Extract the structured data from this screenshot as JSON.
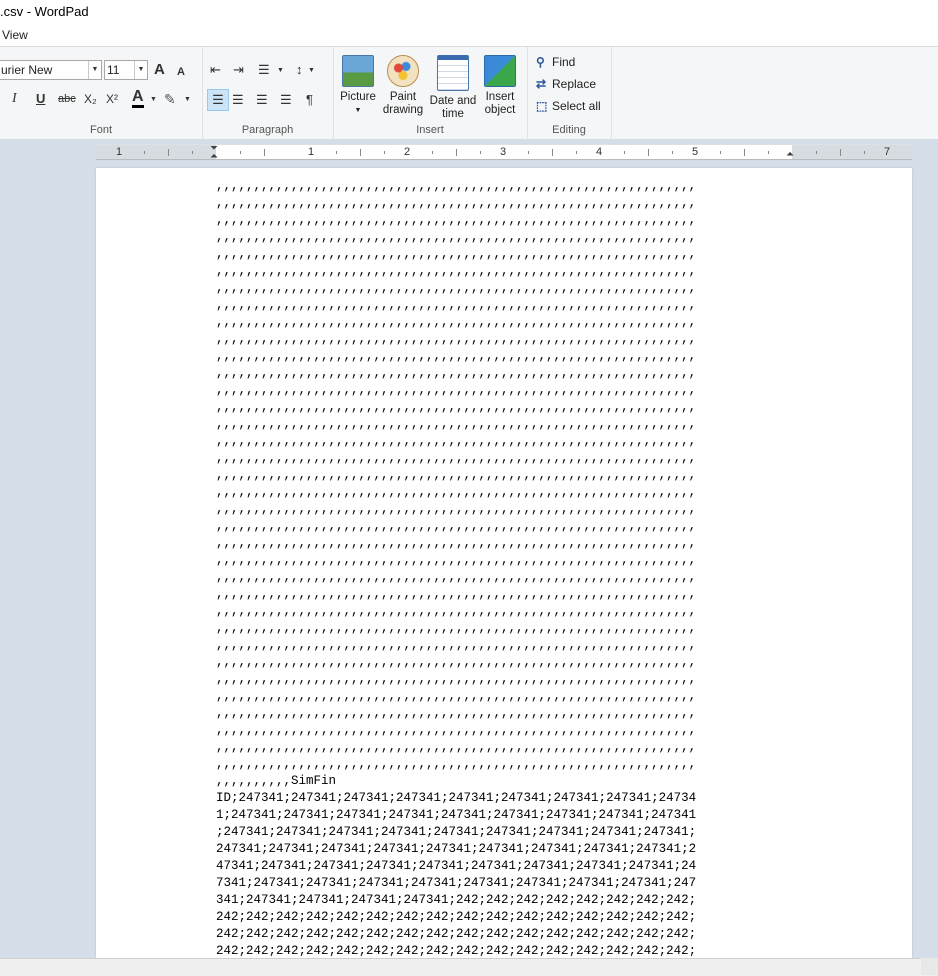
{
  "window": {
    "title": ".csv - WordPad"
  },
  "menu": {
    "view": "View"
  },
  "ribbon": {
    "font": {
      "family": "urier New",
      "size": "11",
      "label": "Font",
      "grow": "A",
      "shrink": "A",
      "italic": "I",
      "underline": "U",
      "strike": "abc",
      "sub": "X₂",
      "sup": "X²",
      "color_letter": "A"
    },
    "paragraph": {
      "label": "Paragraph"
    },
    "insert": {
      "label": "Insert",
      "picture": "Picture",
      "paint": "Paint drawing",
      "datetime": "Date and time",
      "object": "Insert object"
    },
    "editing": {
      "label": "Editing",
      "find": "Find",
      "replace": "Replace",
      "select_all": "Select all"
    }
  },
  "ruler": {
    "numbers": [
      "1",
      "1",
      "2",
      "3",
      "4",
      "5",
      "7"
    ]
  },
  "document": {
    "text": ",,,,,,,,,,,,,,,,,,,,,,,,,,,,,,,,,,,,,,,,,,,,,,,,,,,,,,,,,,,,,,,,\n,,,,,,,,,,,,,,,,,,,,,,,,,,,,,,,,,,,,,,,,,,,,,,,,,,,,,,,,,,,,,,,,\n,,,,,,,,,,,,,,,,,,,,,,,,,,,,,,,,,,,,,,,,,,,,,,,,,,,,,,,,,,,,,,,,\n,,,,,,,,,,,,,,,,,,,,,,,,,,,,,,,,,,,,,,,,,,,,,,,,,,,,,,,,,,,,,,,,\n,,,,,,,,,,,,,,,,,,,,,,,,,,,,,,,,,,,,,,,,,,,,,,,,,,,,,,,,,,,,,,,,\n,,,,,,,,,,,,,,,,,,,,,,,,,,,,,,,,,,,,,,,,,,,,,,,,,,,,,,,,,,,,,,,,\n,,,,,,,,,,,,,,,,,,,,,,,,,,,,,,,,,,,,,,,,,,,,,,,,,,,,,,,,,,,,,,,,\n,,,,,,,,,,,,,,,,,,,,,,,,,,,,,,,,,,,,,,,,,,,,,,,,,,,,,,,,,,,,,,,,\n,,,,,,,,,,,,,,,,,,,,,,,,,,,,,,,,,,,,,,,,,,,,,,,,,,,,,,,,,,,,,,,,\n,,,,,,,,,,,,,,,,,,,,,,,,,,,,,,,,,,,,,,,,,,,,,,,,,,,,,,,,,,,,,,,,\n,,,,,,,,,,,,,,,,,,,,,,,,,,,,,,,,,,,,,,,,,,,,,,,,,,,,,,,,,,,,,,,,\n,,,,,,,,,,,,,,,,,,,,,,,,,,,,,,,,,,,,,,,,,,,,,,,,,,,,,,,,,,,,,,,,\n,,,,,,,,,,,,,,,,,,,,,,,,,,,,,,,,,,,,,,,,,,,,,,,,,,,,,,,,,,,,,,,,\n,,,,,,,,,,,,,,,,,,,,,,,,,,,,,,,,,,,,,,,,,,,,,,,,,,,,,,,,,,,,,,,,\n,,,,,,,,,,,,,,,,,,,,,,,,,,,,,,,,,,,,,,,,,,,,,,,,,,,,,,,,,,,,,,,,\n,,,,,,,,,,,,,,,,,,,,,,,,,,,,,,,,,,,,,,,,,,,,,,,,,,,,,,,,,,,,,,,,\n,,,,,,,,,,,,,,,,,,,,,,,,,,,,,,,,,,,,,,,,,,,,,,,,,,,,,,,,,,,,,,,,\n,,,,,,,,,,,,,,,,,,,,,,,,,,,,,,,,,,,,,,,,,,,,,,,,,,,,,,,,,,,,,,,,\n,,,,,,,,,,,,,,,,,,,,,,,,,,,,,,,,,,,,,,,,,,,,,,,,,,,,,,,,,,,,,,,,\n,,,,,,,,,,,,,,,,,,,,,,,,,,,,,,,,,,,,,,,,,,,,,,,,,,,,,,,,,,,,,,,,\n,,,,,,,,,,,,,,,,,,,,,,,,,,,,,,,,,,,,,,,,,,,,,,,,,,,,,,,,,,,,,,,,\n,,,,,,,,,,,,,,,,,,,,,,,,,,,,,,,,,,,,,,,,,,,,,,,,,,,,,,,,,,,,,,,,\n,,,,,,,,,,,,,,,,,,,,,,,,,,,,,,,,,,,,,,,,,,,,,,,,,,,,,,,,,,,,,,,,\n,,,,,,,,,,,,,,,,,,,,,,,,,,,,,,,,,,,,,,,,,,,,,,,,,,,,,,,,,,,,,,,,\n,,,,,,,,,,,,,,,,,,,,,,,,,,,,,,,,,,,,,,,,,,,,,,,,,,,,,,,,,,,,,,,,\n,,,,,,,,,,,,,,,,,,,,,,,,,,,,,,,,,,,,,,,,,,,,,,,,,,,,,,,,,,,,,,,,\n,,,,,,,,,,,,,,,,,,,,,,,,,,,,,,,,,,,,,,,,,,,,,,,,,,,,,,,,,,,,,,,,\n,,,,,,,,,,,,,,,,,,,,,,,,,,,,,,,,,,,,,,,,,,,,,,,,,,,,,,,,,,,,,,,,\n,,,,,,,,,,,,,,,,,,,,,,,,,,,,,,,,,,,,,,,,,,,,,,,,,,,,,,,,,,,,,,,,\n,,,,,,,,,,,,,,,,,,,,,,,,,,,,,,,,,,,,,,,,,,,,,,,,,,,,,,,,,,,,,,,,\n,,,,,,,,,,,,,,,,,,,,,,,,,,,,,,,,,,,,,,,,,,,,,,,,,,,,,,,,,,,,,,,,\n,,,,,,,,,,,,,,,,,,,,,,,,,,,,,,,,,,,,,,,,,,,,,,,,,,,,,,,,,,,,,,,,\n,,,,,,,,,,,,,,,,,,,,,,,,,,,,,,,,,,,,,,,,,,,,,,,,,,,,,,,,,,,,,,,,\n,,,,,,,,,,,,,,,,,,,,,,,,,,,,,,,,,,,,,,,,,,,,,,,,,,,,,,,,,,,,,,,,\n,,,,,,,,,,,,,,,,,,,,,,,,,,,,,,,,,,,,,,,,,,,,,,,,,,,,,,,,,,,,,,,,\n,,,,,,,,,,SimFin\nID;247341;247341;247341;247341;247341;247341;247341;247341;24734\n1;247341;247341;247341;247341;247341;247341;247341;247341;247341\n;247341;247341;247341;247341;247341;247341;247341;247341;247341;\n247341;247341;247341;247341;247341;247341;247341;247341;247341;2\n47341;247341;247341;247341;247341;247341;247341;247341;247341;24\n7341;247341;247341;247341;247341;247341;247341;247341;247341;247\n341;247341;247341;247341;247341;242;242;242;242;242;242;242;242;\n242;242;242;242;242;242;242;242;242;242;242;242;242;242;242;242;\n242;242;242;242;242;242;242;242;242;242;242;242;242;242;242;242;\n242;242;242;242;242;242;242;242;242;242;242;242;242;242;242;242;"
  }
}
